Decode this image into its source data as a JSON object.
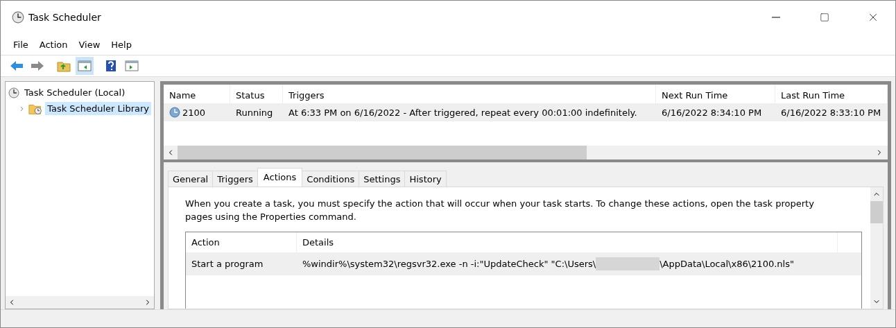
{
  "window": {
    "title": "Task Scheduler"
  },
  "menu": [
    "File",
    "Action",
    "View",
    "Help"
  ],
  "toolbar": [
    {
      "kind": "back",
      "selected": false
    },
    {
      "kind": "forward",
      "selected": false
    },
    {
      "kind": "up",
      "selected": false
    },
    {
      "kind": "tree",
      "selected": true
    },
    {
      "kind": "help",
      "selected": false
    },
    {
      "kind": "pane",
      "selected": false
    }
  ],
  "tree": [
    {
      "label": "Task Scheduler (Local)",
      "selected": false,
      "kind": "clock",
      "children": [
        {
          "label": "Task Scheduler Library",
          "selected": true,
          "kind": "folder",
          "expanded": false
        }
      ]
    }
  ],
  "task_list": {
    "columns": [
      "Name",
      "Status",
      "Triggers",
      "Next Run Time",
      "Last Run Time"
    ],
    "rows": [
      {
        "cells": [
          "2100",
          "Running",
          "At 6:33 PM on 6/16/2022 - After triggered, repeat every 00:01:00 indefinitely.",
          "6/16/2022 8:34:10 PM",
          "6/16/2022 8:33:10 PM"
        ],
        "selected": true
      }
    ]
  },
  "tabs": [
    {
      "label": "General",
      "selected": false
    },
    {
      "label": "Triggers",
      "selected": false
    },
    {
      "label": "Actions",
      "selected": true
    },
    {
      "label": "Conditions",
      "selected": false
    },
    {
      "label": "Settings",
      "selected": false
    },
    {
      "label": "History",
      "selected": false
    }
  ],
  "actions_tab": {
    "intro": "When you create a task, you must specify the action that will occur when your task starts.  To change these actions, open the task property pages using the Properties command.",
    "columns": [
      "Action",
      "Details"
    ],
    "rows": [
      {
        "action": "Start a program",
        "details_before": "%windir%\\system32\\regsvr32.exe -n -i:\"UpdateCheck\" \"C:\\Users\\",
        "redacted": true,
        "details_after": "\\AppData\\Local\\x86\\2100.nls\""
      }
    ]
  }
}
